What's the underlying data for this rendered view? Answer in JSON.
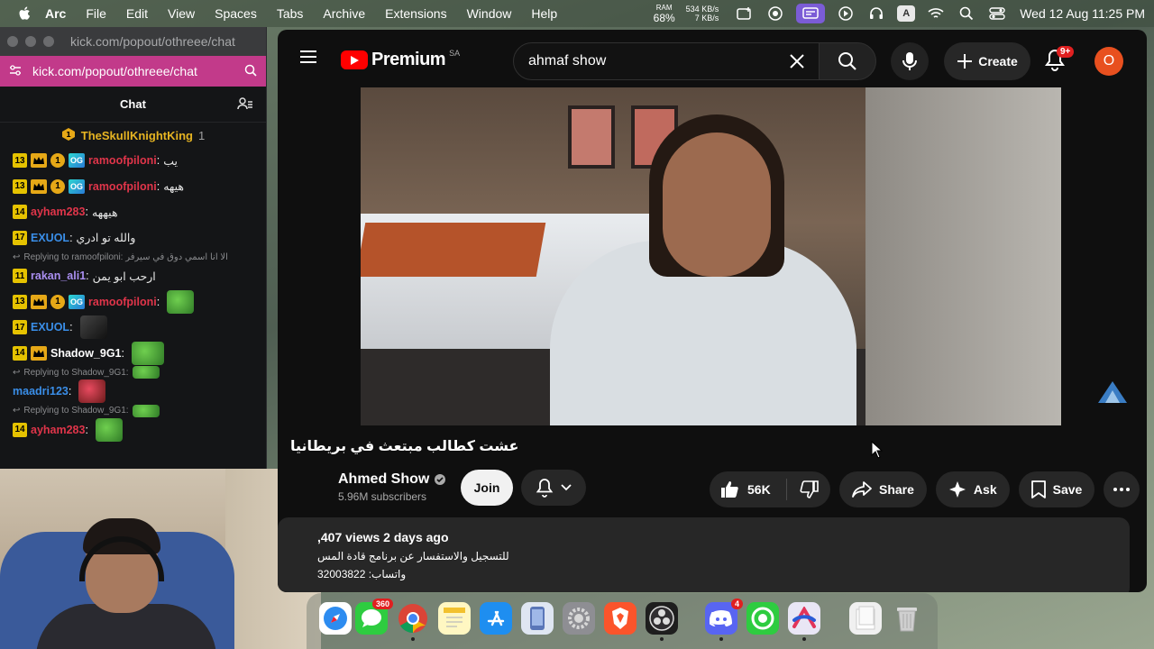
{
  "menubar": {
    "app": "Arc",
    "menus": [
      "File",
      "Edit",
      "View",
      "Spaces",
      "Tabs",
      "Archive",
      "Extensions",
      "Window",
      "Help"
    ],
    "ram_label": "RAM",
    "ram_value": "68%",
    "net_up": "534 KB/s",
    "net_down": "7 KB/s",
    "keyboard_label": "A",
    "datetime": "Wed 12 Aug  11:25 PM"
  },
  "chat_window": {
    "url_top": "kick.com/popout/othreee/chat",
    "url": "kick.com/popout/othreee/chat",
    "header": "Chat",
    "pinned_user": "TheSkullKnightKing",
    "pinned_count": "1",
    "messages": [
      {
        "level": "13",
        "user": "ramoofpiloni",
        "text": "يب"
      },
      {
        "level": "13",
        "user": "ramoofpiloni",
        "text": "هيهه"
      },
      {
        "level": "14",
        "user": "ayham283",
        "text": "هيههه"
      },
      {
        "level": "17",
        "user": "EXUOL",
        "text": "والله تو ادري"
      },
      {
        "reply": "Replying to ramoofpiloni: الا انا اسمي دوق في سيرفر"
      },
      {
        "level": "11",
        "user": "rakan_ali1",
        "text": "ارحب ابو يمن"
      },
      {
        "level": "13",
        "user": "ramoofpiloni",
        "text": ""
      },
      {
        "level": "17",
        "user": "EXUOL",
        "text": ""
      },
      {
        "level": "14",
        "user": "Shadow_9G1",
        "text": ""
      },
      {
        "reply": "Replying to Shadow_9G1:"
      },
      {
        "user": "maadri123",
        "text": ""
      },
      {
        "reply": "Replying to Shadow_9G1:"
      },
      {
        "level": "14",
        "user": "ayham283",
        "text": ""
      }
    ],
    "coin_label": "1",
    "og_label": "OG"
  },
  "youtube": {
    "logo_text": "Premium",
    "logo_country": "SA",
    "search_value": "ahmaf show",
    "create_label": "Create",
    "notifications": "9+",
    "avatar_letter": "O",
    "video_title": "عشت كطالب مبتعث في بريطانيا",
    "channel_name": "Ahmed Show",
    "subscribers": "5.96M subscribers",
    "join_label": "Join",
    "likes": "56K",
    "share_label": "Share",
    "ask_label": "Ask",
    "save_label": "Save",
    "desc_meta": ",407 views  2 days ago",
    "desc_line1": "للتسجيل والاستفسار عن برنامج قادة المس",
    "desc_line2": "واتساب: 32003822"
  },
  "dock": {
    "messages_badge": "360",
    "discord_badge": "4"
  },
  "colors": {
    "kick_urlbar": "#c23a8a",
    "youtube_red": "#ff0000",
    "badge_yellow": "#e5c200",
    "arc_active": "#7b5cd6"
  }
}
